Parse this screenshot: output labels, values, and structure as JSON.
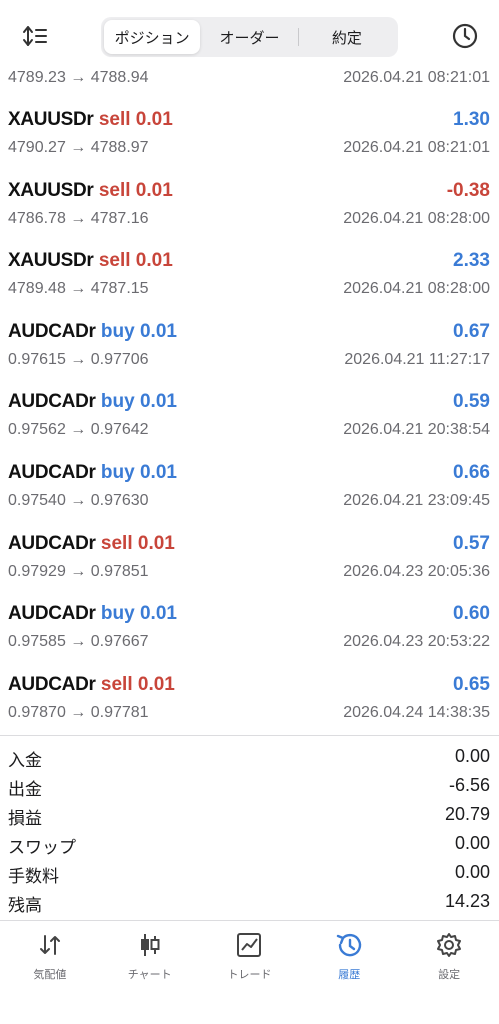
{
  "header": {
    "tabs": [
      {
        "label": "ポジション",
        "active": true
      },
      {
        "label": "オーダー",
        "active": false
      },
      {
        "label": "約定",
        "active": false
      }
    ],
    "left_icon": "sort-icon",
    "right_icon": "clock-icon"
  },
  "first_row": {
    "prices": "4789.23 → 4788.94",
    "time": "2026.04.21 08:21:01"
  },
  "trades": [
    {
      "symbol": "XAUUSDr",
      "side": "sell",
      "volume": "0.01",
      "profit": "1.30",
      "prices": "4790.27 → 4788.97",
      "time": "2026.04.21 08:21:01"
    },
    {
      "symbol": "XAUUSDr",
      "side": "sell",
      "volume": "0.01",
      "profit": "-0.38",
      "prices": "4786.78 → 4787.16",
      "time": "2026.04.21 08:28:00"
    },
    {
      "symbol": "XAUUSDr",
      "side": "sell",
      "volume": "0.01",
      "profit": "2.33",
      "prices": "4789.48 → 4787.15",
      "time": "2026.04.21 08:28:00"
    },
    {
      "symbol": "AUDCADr",
      "side": "buy",
      "volume": "0.01",
      "profit": "0.67",
      "prices": "0.97615 → 0.97706",
      "time": "2026.04.21 11:27:17"
    },
    {
      "symbol": "AUDCADr",
      "side": "buy",
      "volume": "0.01",
      "profit": "0.59",
      "prices": "0.97562 → 0.97642",
      "time": "2026.04.21 20:38:54"
    },
    {
      "symbol": "AUDCADr",
      "side": "buy",
      "volume": "0.01",
      "profit": "0.66",
      "prices": "0.97540 → 0.97630",
      "time": "2026.04.21 23:09:45"
    },
    {
      "symbol": "AUDCADr",
      "side": "sell",
      "volume": "0.01",
      "profit": "0.57",
      "prices": "0.97929 → 0.97851",
      "time": "2026.04.23 20:05:36"
    },
    {
      "symbol": "AUDCADr",
      "side": "buy",
      "volume": "0.01",
      "profit": "0.60",
      "prices": "0.97585 → 0.97667",
      "time": "2026.04.23 20:53:22"
    },
    {
      "symbol": "AUDCADr",
      "side": "sell",
      "volume": "0.01",
      "profit": "0.65",
      "prices": "0.97870 → 0.97781",
      "time": "2026.04.24 14:38:35"
    }
  ],
  "summary": [
    {
      "label": "入金",
      "value": "0.00"
    },
    {
      "label": "出金",
      "value": "-6.56"
    },
    {
      "label": "損益",
      "value": "20.79"
    },
    {
      "label": "スワップ",
      "value": "0.00"
    },
    {
      "label": "手数料",
      "value": "0.00"
    },
    {
      "label": "残高",
      "value": "14.23"
    }
  ],
  "tabbar": [
    {
      "label": "気配値",
      "icon": "quotes-icon",
      "active": false
    },
    {
      "label": "チャート",
      "icon": "candlestick-icon",
      "active": false
    },
    {
      "label": "トレード",
      "icon": "trade-chart-icon",
      "active": false
    },
    {
      "label": "履歴",
      "icon": "history-icon",
      "active": true
    },
    {
      "label": "設定",
      "icon": "gear-icon",
      "active": false
    }
  ],
  "colors": {
    "sell": "#c8453a",
    "buy": "#3a7bd5",
    "profit_positive": "#3a7bd5",
    "profit_negative": "#c8453a",
    "active_tab": "#3a7bd5"
  }
}
